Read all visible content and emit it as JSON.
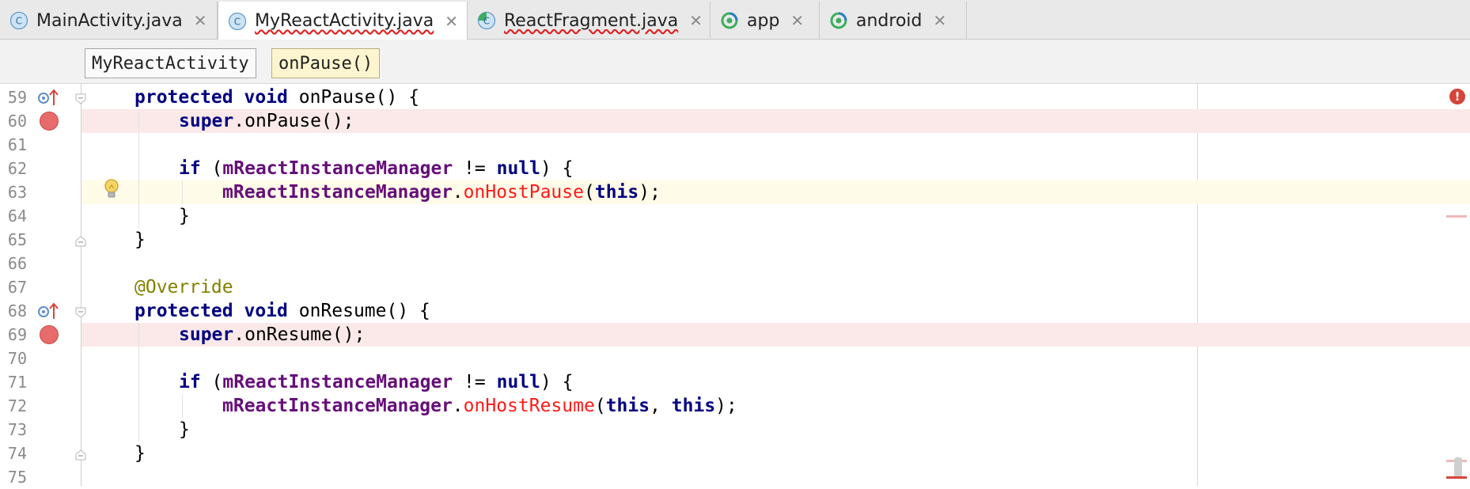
{
  "tabs": [
    {
      "label": "MainActivity.java",
      "icon": "java-class-icon",
      "active": false,
      "has_error": false
    },
    {
      "label": "MyReactActivity.java",
      "icon": "java-class-icon",
      "active": true,
      "has_error": true
    },
    {
      "label": "ReactFragment.java",
      "icon": "java-fragment-class-icon",
      "active": false,
      "has_error": true
    },
    {
      "label": "app",
      "icon": "gradle-module-icon",
      "active": false,
      "has_error": false
    },
    {
      "label": "android",
      "icon": "gradle-module-icon",
      "active": false,
      "has_error": false
    }
  ],
  "tab_close_glyph": "✕",
  "breadcrumbs": [
    "MyReactActivity",
    "onPause()"
  ],
  "editor": {
    "lines": [
      {
        "num": "59",
        "tokens": [
          [
            "protected",
            "kw"
          ],
          [
            " ",
            ""
          ],
          [
            "void",
            "kw"
          ],
          [
            " onPause() {",
            ""
          ]
        ],
        "indent": 1,
        "markers": [
          "override",
          "fold-start"
        ]
      },
      {
        "num": "60",
        "tokens": [
          [
            "super",
            "kw"
          ],
          [
            ".onPause();",
            ""
          ]
        ],
        "indent": 2,
        "markers": [
          "breakpoint"
        ]
      },
      {
        "num": "61",
        "tokens": [],
        "indent": 0,
        "markers": []
      },
      {
        "num": "62",
        "tokens": [
          [
            "if",
            "kw"
          ],
          [
            " (",
            ""
          ],
          [
            "mReactInstanceManager",
            "fld"
          ],
          [
            " != ",
            ""
          ],
          [
            "null",
            "kw"
          ],
          [
            ") {",
            ""
          ]
        ],
        "indent": 2,
        "markers": []
      },
      {
        "num": "63",
        "tokens": [
          [
            "mReactInstanceManager",
            "fld"
          ],
          [
            ".",
            ""
          ],
          [
            "onHostPause",
            "err-call"
          ],
          [
            "(",
            ""
          ],
          [
            "this",
            "kw"
          ],
          [
            ");",
            ""
          ]
        ],
        "indent": 3,
        "markers": [
          "bulb",
          "caret"
        ]
      },
      {
        "num": "64",
        "tokens": [
          [
            "}",
            ""
          ]
        ],
        "indent": 2,
        "markers": []
      },
      {
        "num": "65",
        "tokens": [
          [
            "}",
            ""
          ]
        ],
        "indent": 1,
        "markers": [
          "fold-end"
        ]
      },
      {
        "num": "66",
        "tokens": [],
        "indent": 0,
        "markers": []
      },
      {
        "num": "67",
        "tokens": [
          [
            "@Override",
            "ann"
          ]
        ],
        "indent": 1,
        "markers": []
      },
      {
        "num": "68",
        "tokens": [
          [
            "protected",
            "kw"
          ],
          [
            " ",
            ""
          ],
          [
            "void",
            "kw"
          ],
          [
            " onResume() {",
            ""
          ]
        ],
        "indent": 1,
        "markers": [
          "override",
          "fold-start"
        ]
      },
      {
        "num": "69",
        "tokens": [
          [
            "super",
            "kw"
          ],
          [
            ".onResume();",
            ""
          ]
        ],
        "indent": 2,
        "markers": [
          "breakpoint"
        ]
      },
      {
        "num": "70",
        "tokens": [],
        "indent": 0,
        "markers": []
      },
      {
        "num": "71",
        "tokens": [
          [
            "if",
            "kw"
          ],
          [
            " (",
            ""
          ],
          [
            "mReactInstanceManager",
            "fld"
          ],
          [
            " != ",
            ""
          ],
          [
            "null",
            "kw"
          ],
          [
            ") {",
            ""
          ]
        ],
        "indent": 2,
        "markers": []
      },
      {
        "num": "72",
        "tokens": [
          [
            "mReactInstanceManager",
            "fld"
          ],
          [
            ".",
            ""
          ],
          [
            "onHostResume",
            "err-call"
          ],
          [
            "(",
            ""
          ],
          [
            "this",
            "kw"
          ],
          [
            ", ",
            ""
          ],
          [
            "this",
            "kw"
          ],
          [
            ");",
            ""
          ]
        ],
        "indent": 3,
        "markers": []
      },
      {
        "num": "73",
        "tokens": [
          [
            "}",
            ""
          ]
        ],
        "indent": 2,
        "markers": []
      },
      {
        "num": "74",
        "tokens": [
          [
            "}",
            ""
          ]
        ],
        "indent": 1,
        "markers": [
          "fold-end"
        ]
      },
      {
        "num": "75",
        "tokens": [],
        "indent": 0,
        "markers": []
      }
    ],
    "error_badge": "!"
  },
  "colors": {
    "keyword": "#000080",
    "field": "#660e7a",
    "error_call": "#ff1a1a",
    "annotation": "#808000",
    "breakpoint_line": "#fbe9e9",
    "caret_line": "#fefbe8"
  }
}
